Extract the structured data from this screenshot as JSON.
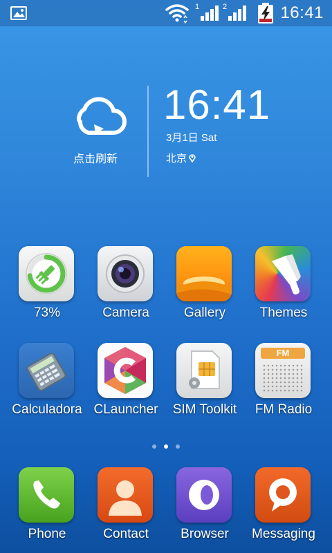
{
  "status_bar": {
    "time": "16:41",
    "sim1_label": "1",
    "sim2_label": "2",
    "icons": [
      "gallery-notification-icon",
      "wifi-icon",
      "signal-sim1-icon",
      "signal-sim2-icon",
      "battery-charging-icon"
    ]
  },
  "widget": {
    "weather_refresh": "点击刷新",
    "weather_icon": "cloud-refresh-icon",
    "clock": "16:41",
    "date": "3月1日 Sat",
    "city": "北京",
    "city_icon": "location-pin-icon"
  },
  "apps": [
    {
      "label": "73%",
      "icon": "cleaner-icon"
    },
    {
      "label": "Camera",
      "icon": "camera-icon"
    },
    {
      "label": "Gallery",
      "icon": "gallery-icon"
    },
    {
      "label": "Themes",
      "icon": "themes-icon"
    },
    {
      "label": "Calculadora",
      "icon": "calculator-icon"
    },
    {
      "label": "CLauncher",
      "icon": "claucher-icon"
    },
    {
      "label": "SIM Toolkit",
      "icon": "sim-toolkit-icon"
    },
    {
      "label": "FM Radio",
      "icon": "fm-radio-icon"
    }
  ],
  "fm_badge": "FM",
  "cleaner_progress": 0.73,
  "pages": {
    "count": 3,
    "active_index": 1
  },
  "dock": [
    {
      "label": "Phone",
      "icon": "phone-icon"
    },
    {
      "label": "Contact",
      "icon": "contact-icon"
    },
    {
      "label": "Browser",
      "icon": "browser-icon"
    },
    {
      "label": "Messaging",
      "icon": "messaging-icon"
    }
  ]
}
